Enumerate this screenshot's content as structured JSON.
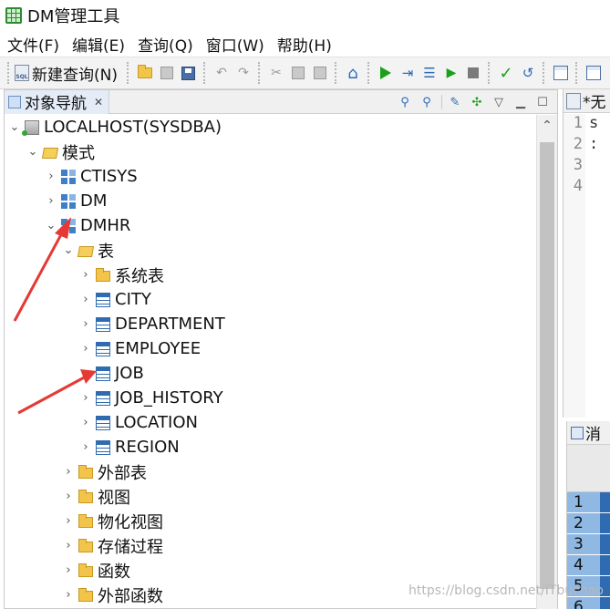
{
  "window": {
    "title": "DM管理工具"
  },
  "menu": [
    "文件(F)",
    "编辑(E)",
    "查询(Q)",
    "窗口(W)",
    "帮助(H)"
  ],
  "toolbar": {
    "new_query_label": "新建查询(N)"
  },
  "navigator": {
    "tab_label": "对象导航",
    "tree": [
      {
        "label": "LOCALHOST(SYSDBA)",
        "icon": "server-icon",
        "expanded": true
      },
      {
        "label": "模式",
        "icon": "folder-open-icon",
        "expanded": true
      },
      {
        "label": "CTISYS",
        "icon": "schema-icon",
        "expanded": false
      },
      {
        "label": "DM",
        "icon": "schema-icon",
        "expanded": false
      },
      {
        "label": "DMHR",
        "icon": "schema-icon",
        "expanded": true
      },
      {
        "label": "表",
        "icon": "folder-open-icon",
        "expanded": true
      },
      {
        "label": "系统表",
        "icon": "folder-icon",
        "expanded": false
      },
      {
        "label": "CITY",
        "icon": "table-icon",
        "expanded": false
      },
      {
        "label": "DEPARTMENT",
        "icon": "table-icon",
        "expanded": false
      },
      {
        "label": "EMPLOYEE",
        "icon": "table-icon",
        "expanded": false
      },
      {
        "label": "JOB",
        "icon": "table-icon",
        "expanded": false
      },
      {
        "label": "JOB_HISTORY",
        "icon": "table-icon",
        "expanded": false
      },
      {
        "label": "LOCATION",
        "icon": "table-icon",
        "expanded": false
      },
      {
        "label": "REGION",
        "icon": "table-icon",
        "expanded": false
      },
      {
        "label": "外部表",
        "icon": "folder-icon",
        "expanded": false
      },
      {
        "label": "视图",
        "icon": "folder-icon",
        "expanded": false
      },
      {
        "label": "物化视图",
        "icon": "folder-icon",
        "expanded": false
      },
      {
        "label": "存储过程",
        "icon": "folder-icon",
        "expanded": false
      },
      {
        "label": "函数",
        "icon": "folder-icon",
        "expanded": false
      },
      {
        "label": "外部函数",
        "icon": "folder-icon",
        "expanded": false
      }
    ]
  },
  "editor": {
    "tab_label": "*无",
    "line_numbers": [
      "1",
      "2",
      "3",
      "4"
    ],
    "code_fragments": [
      "s",
      ":",
      "",
      ""
    ]
  },
  "messages": {
    "tab_label": "消",
    "row_numbers": [
      "1",
      "2",
      "3",
      "4",
      "5",
      "6"
    ]
  },
  "watermark": "https://blog.csdn.net/ITbuchao",
  "colors": {
    "annotation_arrow": "#e53935",
    "selection": "#2f6bb0",
    "row_header": "#8fb8e3"
  }
}
